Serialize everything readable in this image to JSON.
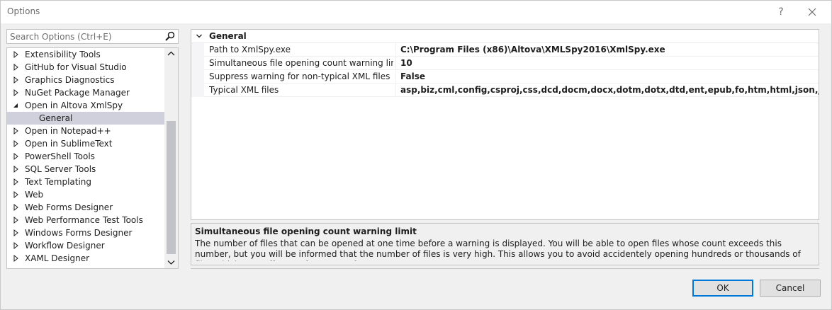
{
  "window": {
    "title": "Options",
    "help_label": "?",
    "close_label": "✕"
  },
  "search": {
    "placeholder": "Search Options (Ctrl+E)"
  },
  "tree": {
    "items": [
      {
        "label": "Extensibility Tools",
        "expanded": false
      },
      {
        "label": "GitHub for Visual Studio",
        "expanded": false
      },
      {
        "label": "Graphics Diagnostics",
        "expanded": false
      },
      {
        "label": "NuGet Package Manager",
        "expanded": false
      },
      {
        "label": "Open in Altova XmlSpy",
        "expanded": true
      },
      {
        "label": "General",
        "child": true,
        "selected": true
      },
      {
        "label": "Open in Notepad++",
        "expanded": false
      },
      {
        "label": "Open in SublimeText",
        "expanded": false
      },
      {
        "label": "PowerShell Tools",
        "expanded": false
      },
      {
        "label": "SQL Server Tools",
        "expanded": false
      },
      {
        "label": "Text Templating",
        "expanded": false
      },
      {
        "label": "Web",
        "expanded": false
      },
      {
        "label": "Web Forms Designer",
        "expanded": false
      },
      {
        "label": "Web Performance Test Tools",
        "expanded": false
      },
      {
        "label": "Windows Forms Designer",
        "expanded": false
      },
      {
        "label": "Workflow Designer",
        "expanded": false
      },
      {
        "label": "XAML Designer",
        "expanded": false
      }
    ]
  },
  "grid": {
    "category": "General",
    "properties": [
      {
        "name": "Path to XmlSpy.exe",
        "value": "C:\\Program Files (x86)\\Altova\\XMLSpy2016\\XmlSpy.exe"
      },
      {
        "name": "Simultaneous file opening count warning limit",
        "value": "10"
      },
      {
        "name": "Suppress warning for non-typical XML files",
        "value": "False"
      },
      {
        "name": "Typical XML files",
        "value": "asp,biz,cml,config,csproj,css,dcd,docm,docx,dotm,dotx,dtd,ent,epub,fo,htm,html,json,jsp,math,mml,potm,potx"
      }
    ]
  },
  "description": {
    "title": "Simultaneous file opening count warning limit",
    "text": "The number of files that can be opened at one time before a warning is displayed. You will be able to open files whose count exceeds this number, but you will be informed that the number of files is very high. This allows you to avoid accidentely opening hundreds or thousands of files which may affect performance of your m..."
  },
  "buttons": {
    "ok": "OK",
    "cancel": "Cancel"
  },
  "colors": {
    "selection": "#cfd0db",
    "accent": "#0078d7"
  }
}
